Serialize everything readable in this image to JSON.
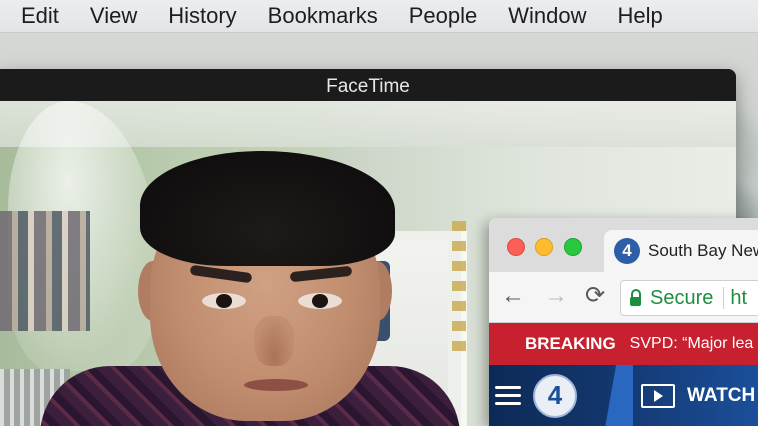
{
  "menubar": {
    "items": [
      "Edit",
      "View",
      "History",
      "Bookmarks",
      "People",
      "Window",
      "Help"
    ]
  },
  "facetime": {
    "title": "FaceTime"
  },
  "browser": {
    "tab": {
      "favicon_text": "4",
      "title": "South Bay New"
    },
    "toolbar": {
      "back_icon": "←",
      "forward_icon": "→",
      "reload_icon": "⟳",
      "secure_label": "Secure",
      "url_fragment": "ht"
    },
    "breaking": {
      "label": "BREAKING",
      "text": "SVPD: “Major lea"
    },
    "sitenav": {
      "logo_text": "4",
      "watch_label": "WATCH L"
    },
    "colors": {
      "breaking_red": "#c7202f",
      "nav_blue": "#12356a",
      "secure_green": "#1e8e3e"
    }
  }
}
